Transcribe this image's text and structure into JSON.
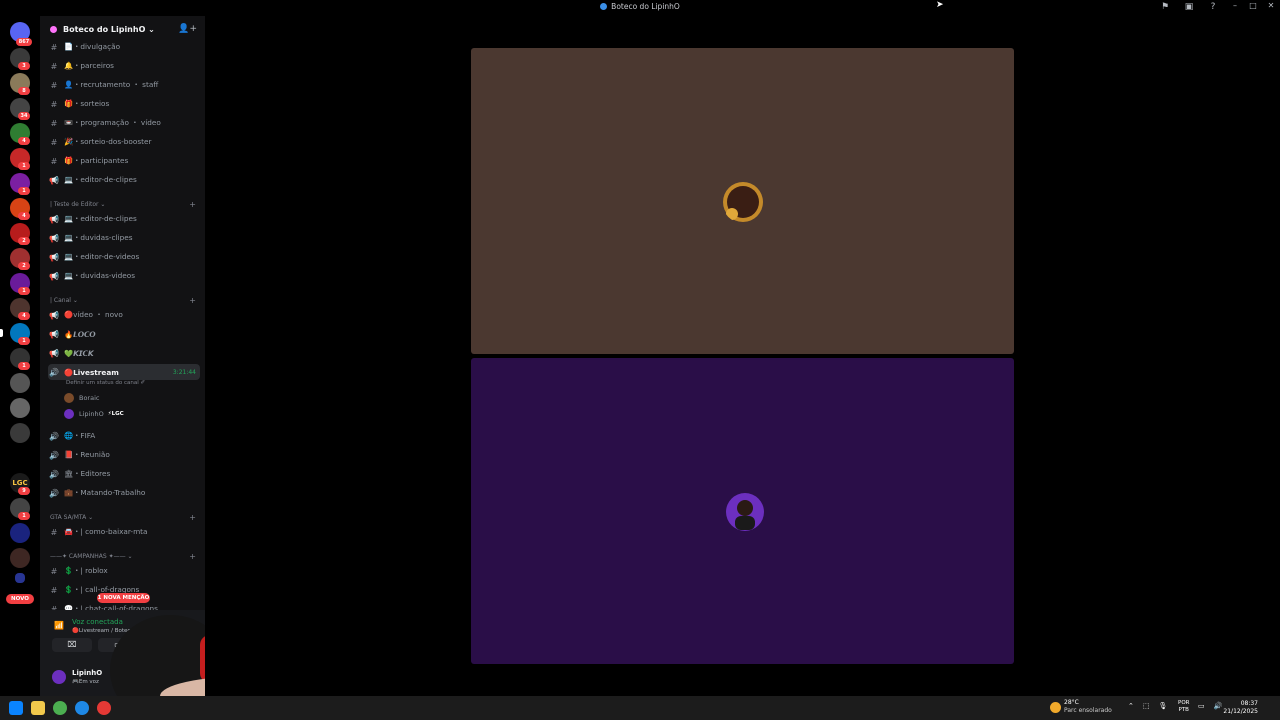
{
  "window": {
    "title": "Boteco do LipinhO"
  },
  "guild": {
    "name": "Boteco do LipinhO",
    "channels_top": [
      {
        "icon": "text-channel-icon",
        "label": "📄・divulgação"
      },
      {
        "icon": "text-channel-icon",
        "label": "🔔・parceiros"
      },
      {
        "icon": "text-channel-icon",
        "label": "👤・recrutamento ・ staff"
      },
      {
        "icon": "text-channel-icon",
        "label": "🎁・sorteios"
      },
      {
        "icon": "text-channel-icon",
        "label": "📼・programação ・ vídeo"
      },
      {
        "icon": "text-channel-icon",
        "label": "🎉・sorteio-dos-booster"
      },
      {
        "icon": "text-channel-icon",
        "label": "🎁・participantes"
      },
      {
        "icon": "announce-channel-icon",
        "label": "💻・editor-de-clipes"
      }
    ],
    "categories": {
      "teste": "| Teste de Editor ⌄",
      "canal": "| Canal ⌄",
      "gta": "GTA SA/MTA ⌄",
      "campanhas": "——✦ CAMPANHAS ✦—— ⌄"
    },
    "channels_teste": [
      {
        "label": "💻・editor-de-clipes"
      },
      {
        "label": "💻・duvidas-clipes"
      },
      {
        "label": "💻・editor-de-videos"
      },
      {
        "label": "💻・duvidas-videos"
      }
    ],
    "channels_canal": [
      {
        "label": "🔴vídeo ・ novo"
      },
      {
        "label": "🔥𝙇𝙊𝘾𝙊"
      },
      {
        "label": "💚𝙆𝙄𝘾𝙆"
      }
    ],
    "livestream": {
      "label": "🔴Livestream",
      "timer": "3:21:44",
      "status": "Definir um status do canal ✐",
      "users": [
        {
          "name": "Boraic"
        },
        {
          "name": "LipinhO",
          "tag": "⚡LGC"
        }
      ]
    },
    "channels_voice": [
      {
        "label": "🌐・FIFA"
      },
      {
        "label": "📕・Reunião"
      },
      {
        "label": "🏛・Editores"
      },
      {
        "label": "💼・Matando-Trabalho"
      }
    ],
    "channels_gta": [
      {
        "label": "🚘・| como-baixar-mta"
      }
    ],
    "channels_campanhas": [
      {
        "label": "💲・| roblox"
      },
      {
        "label": "💲・| call-of-dragons"
      },
      {
        "label": "💬・| chat-call-of-dragons"
      }
    ],
    "mention_badge": "1 NOVA MENÇÃO"
  },
  "servers": {
    "badges": [
      "867",
      "3",
      "8",
      "34",
      "4",
      "1",
      "1",
      "4",
      "2",
      "2",
      "1",
      "4",
      "1",
      "1",
      "9",
      "1"
    ],
    "novo_label": "NOVO",
    "lgc_label": "LGC"
  },
  "voice": {
    "status": "Voz conectada",
    "location": "🔴Livestream / Boteco do LipinhO"
  },
  "user": {
    "name": "LipinhO",
    "status": "🎮Em voz"
  },
  "taskbar": {
    "weather_temp": "28°C",
    "weather_cond": "Parc ensolarado",
    "lang": "POR",
    "lang2": "PTB",
    "time": "08:37",
    "date": "21/12/2025"
  },
  "colors": {
    "tile_top": "#4b3830",
    "tile_bottom": "#2a0e48",
    "accent_green": "#23a55a",
    "badge_red": "#f23f42"
  }
}
